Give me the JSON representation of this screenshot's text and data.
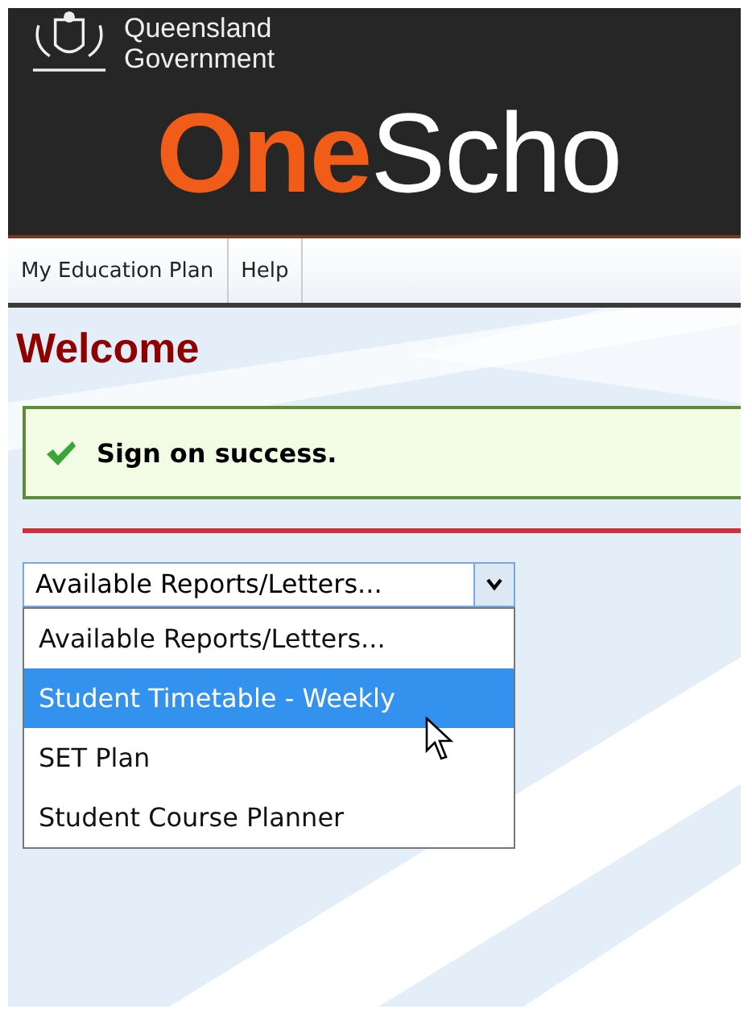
{
  "header": {
    "government_line_1": "Queensland",
    "government_line_2": "Government",
    "logo_part_1": "One",
    "logo_part_2": "Scho"
  },
  "nav": [
    {
      "label": "My Education Plan"
    },
    {
      "label": "Help"
    }
  ],
  "heading": "Welcome",
  "message": {
    "kind": "success",
    "text": "Sign on success."
  },
  "reports_select": {
    "value": "Available Reports/Letters...",
    "expanded": true,
    "options": [
      {
        "label": "Available Reports/Letters...",
        "highlighted": false
      },
      {
        "label": "Student Timetable - Weekly",
        "highlighted": true
      },
      {
        "label": "SET Plan",
        "highlighted": false
      },
      {
        "label": "Student Course Planner",
        "highlighted": false
      }
    ]
  }
}
